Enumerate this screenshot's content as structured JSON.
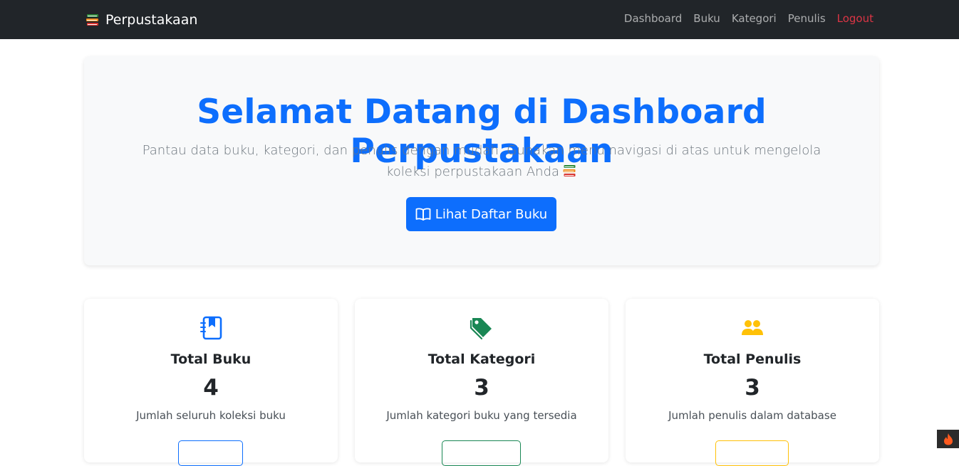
{
  "navbar": {
    "brand_icon": "books-icon",
    "brand_label": "Perpustakaan",
    "links": [
      {
        "label": "Dashboard"
      },
      {
        "label": "Buku"
      },
      {
        "label": "Kategori"
      },
      {
        "label": "Penulis"
      },
      {
        "label": "Logout"
      }
    ]
  },
  "hero": {
    "title": "Selamat Datang di Dashboard Perpustakaan",
    "subtitle": "Pantau data buku, kategori, dan penulis dengan mudah. Gunakan menu navigasi di atas untuk mengelola koleksi perpustakaan Anda",
    "button_icon": "open-book-icon",
    "button_label": "Lihat Daftar Buku"
  },
  "cards": [
    {
      "icon": "book-bookmark-icon",
      "color": "#0d6efd",
      "title": "Total Buku",
      "count": "4",
      "desc": "Jumlah seluruh koleksi buku"
    },
    {
      "icon": "tag-icon",
      "color": "#198754",
      "title": "Total Kategori",
      "count": "3",
      "desc": "Jumlah kategori buku yang tersedia"
    },
    {
      "icon": "people-icon",
      "color": "#ffc107",
      "title": "Total Penulis",
      "count": "3",
      "desc": "Jumlah penulis dalam database"
    }
  ],
  "colors": {
    "navbar_bg": "#212529",
    "primary": "#0d6efd",
    "success": "#198754",
    "warning": "#ffc107",
    "danger": "#dc3545"
  },
  "corner_badge_icon": "fire-icon"
}
